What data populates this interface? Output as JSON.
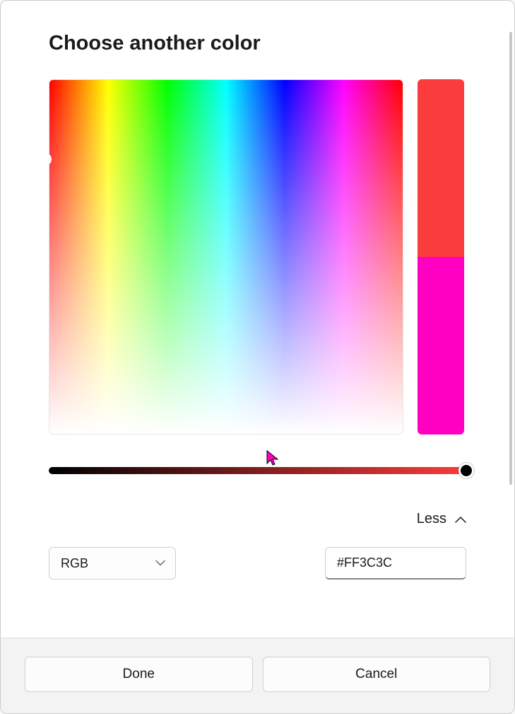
{
  "title": "Choose another color",
  "swatches": {
    "current": "#fb3c3c",
    "previous": "#ff00c3"
  },
  "slider": {
    "track_start": "#000000",
    "track_end": "#fb3c3c",
    "value_percent": 100
  },
  "toggle": {
    "label": "Less"
  },
  "color_model": {
    "selected": "RGB"
  },
  "hex": {
    "value": "#FF3C3C"
  },
  "buttons": {
    "done": "Done",
    "cancel": "Cancel"
  }
}
